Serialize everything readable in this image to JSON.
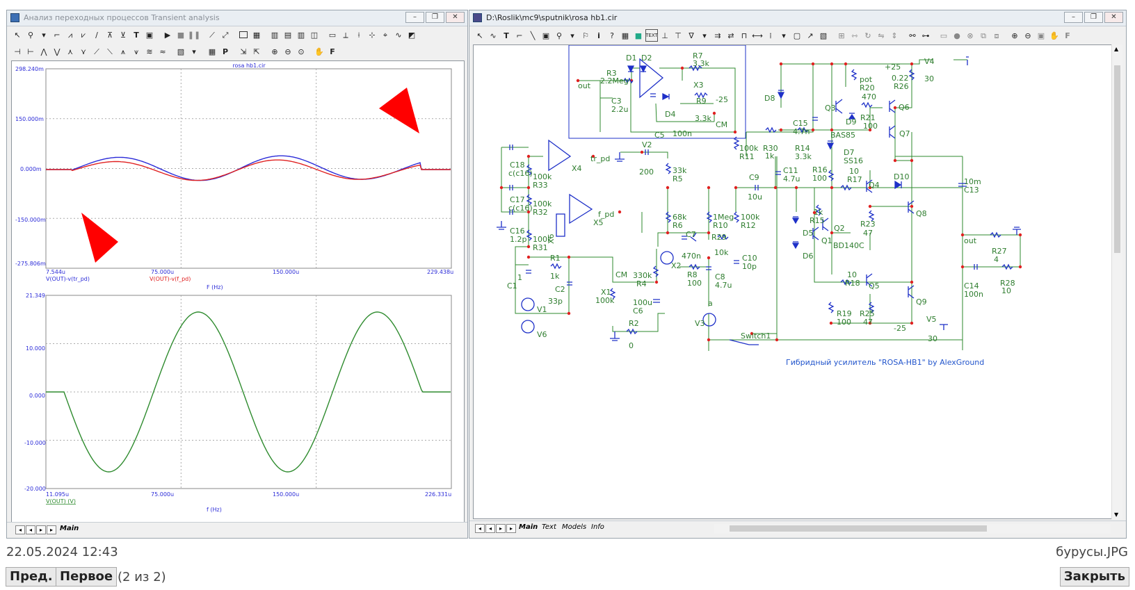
{
  "left_window": {
    "title": "Анализ переходных процессов Transient analysis",
    "tab": "Main",
    "plot1": {
      "title": "rosa hb1.cir",
      "y_ticks": [
        "298.240m",
        "150.000m",
        "0.000m",
        "-150.000m",
        "-275.806m"
      ],
      "x_ticks": [
        "7.544u",
        "75.000u",
        "150.000u",
        "229.438u"
      ],
      "trace_blue_label": "V(OUT)-v(tr_pd)",
      "trace_red_label": "V(OUT)-v(f_pd)",
      "xlabel": "F (Hz)"
    },
    "plot2": {
      "y_ticks": [
        "21.349",
        "10.000",
        "0.000",
        "-10.000",
        "-20.000"
      ],
      "x_ticks": [
        "11.095u",
        "75.000u",
        "150.000u",
        "226.331u"
      ],
      "trace_label": "V(OUT) (V)",
      "xlabel": "f (Hz)"
    }
  },
  "right_window": {
    "title": "D:\\Roslik\\mc9\\sputnik\\rosa hb1.cir",
    "tabs": [
      "Main",
      "Text",
      "Models",
      "Info"
    ],
    "caption": "Гибридный усилитель \"ROSA-HB1\" by AlexGround",
    "labels": {
      "d1": "D1",
      "d2": "D2",
      "r7": "R7",
      "r7v": "3.3k",
      "r3": "R3",
      "r3v": "2.2Meg",
      "out": "out",
      "x3": "X3",
      "c3": "C3",
      "c3v": "2.2u",
      "r9": "R9",
      "r9v": "3.3k",
      "n25": "-25",
      "d4": "D4",
      "cm": "CM",
      "c5": "C5",
      "c5v": "100n",
      "p25": "+25",
      "v4": "V4",
      "v4v": "30",
      "pot": "pot",
      "r20": "R20",
      "r20v": "470",
      "r26v": "0.22",
      "r26": "R26",
      "d8": "D8",
      "q3": "Q3",
      "d9": "D9",
      "r21": "R21",
      "r21v": "100",
      "q6": "Q6",
      "bas85": "BAS85",
      "q7": "Q7",
      "c15": "C15",
      "c15v": "4.7n",
      "r11v": "100k",
      "r11": "R11",
      "r30": "R30",
      "r30v": "1k",
      "r14": "R14",
      "r14v": "3.3k",
      "d7": "D7",
      "ss16": "SS16",
      "c18": "C18",
      "c18v": "c(c16)",
      "r33v": "100k",
      "r33": "R33",
      "x4": "X4",
      "trpd": "tr_pd",
      "v2": "V2",
      "v2v": "200",
      "r5v": "33k",
      "r5": "R5",
      "c9": "C9",
      "c9v": "10u",
      "c11": "C11",
      "c11v": "4.7u",
      "r16": "R16",
      "r16v": "100",
      "r17v": "10",
      "r17": "R17",
      "q4": "Q4",
      "d10": "D10",
      "c13v": "10m",
      "c13": "C13",
      "c17": "C17",
      "c17v": "c(c16)",
      "r32v": "100k",
      "r32": "R32",
      "fpd": "f_pd",
      "x5": "X5",
      "r6v": "68k",
      "r6": "R6",
      "r10v": "1Meg",
      "r10": "R10",
      "r12v": "100k",
      "r12": "R12",
      "r15v": "1k",
      "r15": "R15",
      "q2": "Q2",
      "q8": "Q8",
      "c16": "C16",
      "c16v": "1.2p",
      "r31v": "100k",
      "r31": "R31",
      "x6": "X6",
      "c7": "C7",
      "r29": "R29",
      "d5": "D5",
      "q1": "Q1",
      "r23": "R23",
      "r23v": "47",
      "out2": "out",
      "c7v": "470n",
      "r29v": "10k",
      "c10": "C10",
      "c10v": "10p",
      "d6": "D6",
      "bd140c": "BD140C",
      "r27": "R27",
      "r27v": "4",
      "r1": "R1",
      "r1v": "1k",
      "c1": "C1",
      "c1v": "1",
      "c2": "C2",
      "c2v": "33p",
      "x1": "X1",
      "x1v": "100k",
      "cm2": "CM",
      "r4v": "330k",
      "r4": "R4",
      "x2": "X2",
      "r8": "R8",
      "r8v": "100",
      "c8": "C8",
      "c8v": "4.7u",
      "r18v": "10",
      "r18": "R18",
      "q5": "Q5",
      "c14": "C14",
      "c14v": "100n",
      "r28": "R28",
      "r28v": "10",
      "v1": "V1",
      "c6v": "100u",
      "c6": "C6",
      "a": "a",
      "v3": "V3",
      "r19": "R19",
      "r19v": "100",
      "r25": "R25",
      "r25v": "47",
      "q9": "Q9",
      "v5": "V5",
      "v5v": "30",
      "v6": "V6",
      "r2": "R2",
      "r2v": "0",
      "sw1": "Switch1",
      "n25b": "-25"
    }
  },
  "footer": {
    "date": "22.05.2024 12:43",
    "filename": "бурусы.JPG",
    "prev": "Пред.",
    "first": "Первое",
    "position": "(2 из 2)",
    "close": "Закрыть"
  },
  "colors": {
    "blue_trace": "#2b2bd8",
    "red_trace": "#e02020",
    "green_trace": "#2e8b2e",
    "wire": "#2c8a2c",
    "component": "#1e30c8",
    "node": "#e02020"
  }
}
